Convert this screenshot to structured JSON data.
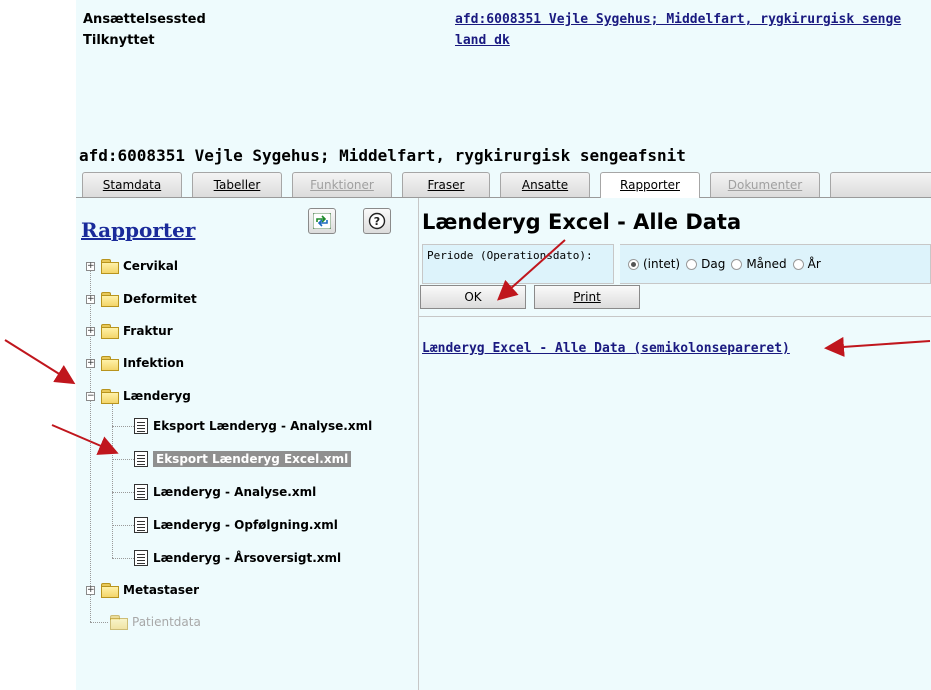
{
  "header": {
    "fields": [
      {
        "label": "Ansættelsessted",
        "value": "afd:6008351 Vejle Sygehus; Middelfart, rygkirurgisk senge"
      },
      {
        "label": "Tilknyttet",
        "value": "land dk"
      }
    ],
    "department_title": "afd:6008351 Vejle Sygehus; Middelfart, rygkirurgisk sengeafsnit"
  },
  "tabs": [
    {
      "label": "Stamdata",
      "state": "normal"
    },
    {
      "label": "Tabeller",
      "state": "normal"
    },
    {
      "label": "Funktioner",
      "state": "disabled"
    },
    {
      "label": "Fraser",
      "state": "normal"
    },
    {
      "label": "Ansatte",
      "state": "normal"
    },
    {
      "label": "Rapporter",
      "state": "active"
    },
    {
      "label": "Dokumenter",
      "state": "disabled"
    }
  ],
  "left": {
    "title": "Rapporter",
    "tree": [
      {
        "label": "Cervikal",
        "expander": "+"
      },
      {
        "label": "Deformitet",
        "expander": "+"
      },
      {
        "label": "Fraktur",
        "expander": "+"
      },
      {
        "label": "Infektion",
        "expander": "+"
      },
      {
        "label": "Lænderyg",
        "expander": "−"
      },
      {
        "label": "Metastaser",
        "expander": "+"
      },
      {
        "label": "Patientdata"
      }
    ],
    "children": [
      {
        "label": "Eksport Lænderyg - Analyse.xml"
      },
      {
        "label": "Eksport Lænderyg Excel.xml",
        "selected": true
      },
      {
        "label": "Lænderyg - Analyse.xml"
      },
      {
        "label": "Lænderyg - Opfølgning.xml"
      },
      {
        "label": "Lænderyg - Årsoversigt.xml"
      }
    ],
    "icons": {
      "refresh": "refresh-icon",
      "help": "help-icon"
    }
  },
  "report": {
    "title": "Lænderyg Excel - Alle Data",
    "periode_label": "Periode (Operationsdato):",
    "periode_options": [
      "(intet)",
      "Dag",
      "Måned",
      "År"
    ],
    "periode_selected": "(intet)",
    "ok_label": "OK",
    "print_label": "Print",
    "export_link": "Lænderyg Excel - Alle Data (semikolonsepareret)"
  },
  "colors": {
    "panel_bg": "#eefbfd",
    "link": "#1a1a80",
    "arrow": "#c0161d",
    "selection": "#8f8f8f"
  }
}
